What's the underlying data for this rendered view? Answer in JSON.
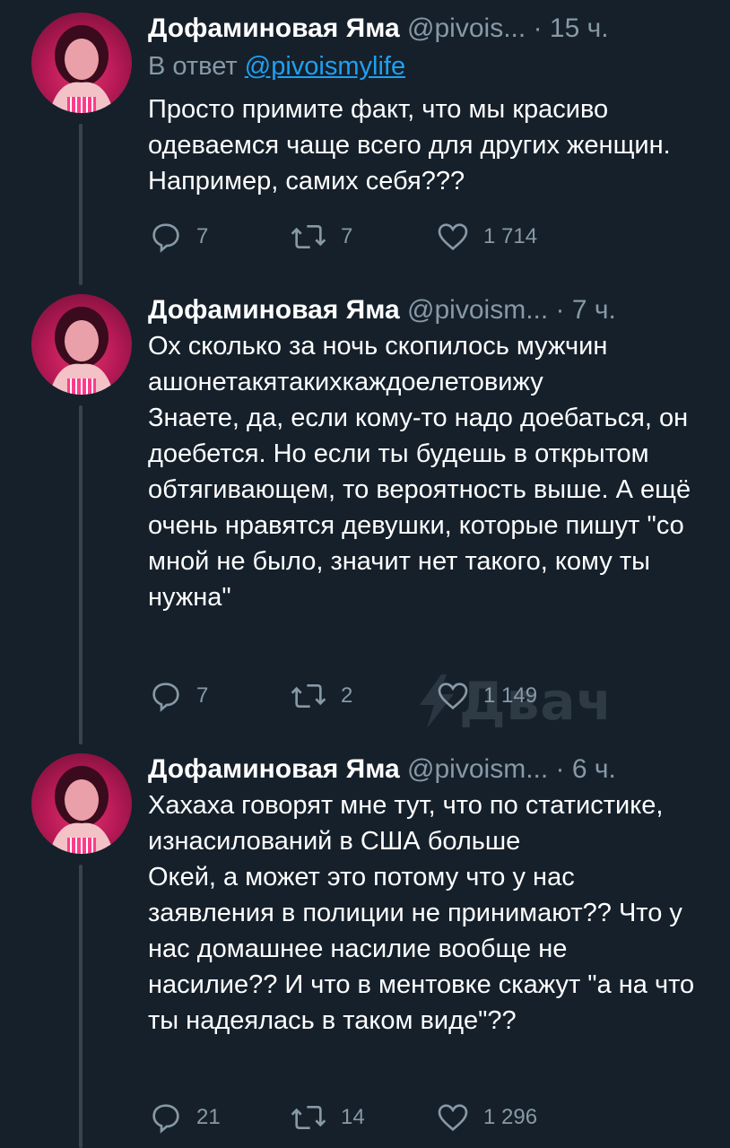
{
  "tweets": [
    {
      "name": "Дофаминовая Яма",
      "handle": "@pivois...",
      "dot": "·",
      "time": "15 ч.",
      "reply_prefix": "В ответ",
      "reply_to": "@pivoismylife",
      "text": "Просто примите факт, что мы красиво одеваемся чаще всего для других женщин. Например, самих себя???",
      "replies": "7",
      "retweets": "7",
      "likes": "1 714"
    },
    {
      "name": "Дофаминовая Яма",
      "handle": "@pivoism...",
      "dot": "·",
      "time": "7 ч.",
      "text": "Ох сколько за ночь скопилось мужчин\nашонетакятакихкаждоелетовижу\nЗнаете, да, если кому-то надо доебаться, он доебется. Но если ты будешь в открытом обтягивающем, то вероятность выше. А ещё очень нравятся девушки, которые пишут \"со мной не было, значит нет такого, кому ты нужна\"",
      "replies": "7",
      "retweets": "2",
      "likes": "1 149"
    },
    {
      "name": "Дофаминовая Яма",
      "handle": "@pivoism...",
      "dot": "·",
      "time": "6 ч.",
      "text": "Хахаха говорят мне тут, что по статистике, изнасилований в США больше\nОкей, а может это потому что у нас заявления в полиции не принимают?? Что у нас домашнее насилие вообще не насилие?? И что в ментовке скажут \"а на что ты надеялась в таком виде\"??",
      "replies": "21",
      "retweets": "14",
      "likes": "1 296"
    }
  ],
  "watermark": "Двач",
  "icons": {
    "reply": "reply-icon",
    "retweet": "retweet-icon",
    "like": "heart-icon"
  },
  "colors": {
    "background": "#15202b",
    "secondary_text": "#8899a6",
    "link": "#1da1f2",
    "thread_line": "#38444d"
  }
}
